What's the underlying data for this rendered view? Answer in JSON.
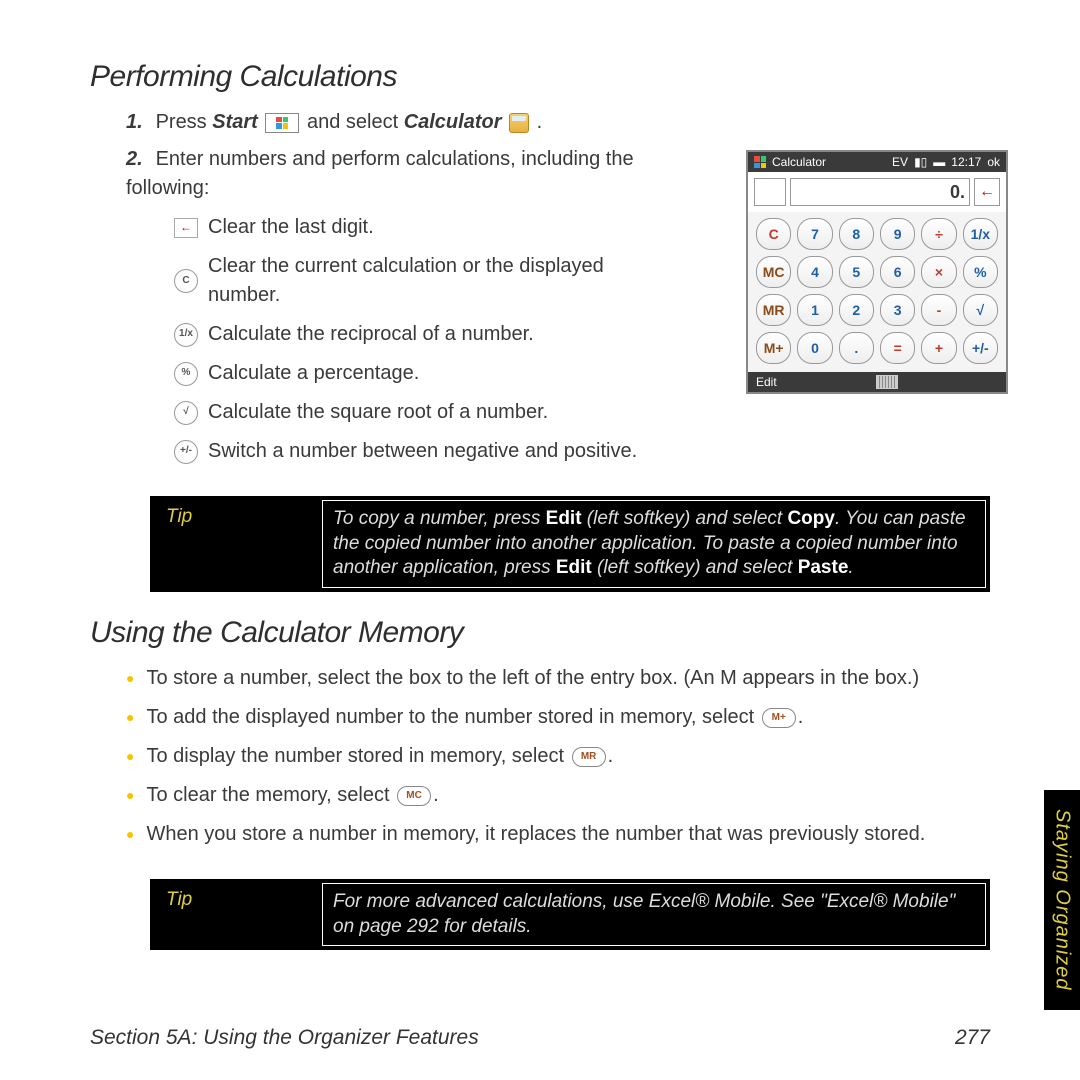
{
  "h1": "Performing Calculations",
  "step1_a": "Press ",
  "step1_start": "Start",
  "step1_b": " and select ",
  "step1_calc": "Calculator",
  "step1_c": " .",
  "step2": "Enter numbers and perform calculations, including the following:",
  "sub": {
    "a": "Clear the last digit.",
    "b": "Clear the current calculation or the displayed number.",
    "c": "Calculate the reciprocal of a number.",
    "d": "Calculate a percentage.",
    "e": "Calculate the square root of a number.",
    "f": "Switch a number between negative and positive."
  },
  "tip1_label": "Tip",
  "tip1_a": "To copy a number, press ",
  "tip1_edit1": "Edit",
  "tip1_b": " (left softkey) and select ",
  "tip1_copy": "Copy",
  "tip1_c": ". You can paste the copied number into another application. To paste a copied number into another application, press ",
  "tip1_edit2": "Edit",
  "tip1_d": " (left softkey) and select ",
  "tip1_paste": "Paste",
  "tip1_e": ".",
  "h2": "Using the Calculator Memory",
  "bul": {
    "a": "To store a number, select the box to the left of the entry box. (An M appears in the box.)",
    "b_a": "To add the displayed number to the number stored in memory, select ",
    "b_key": "M+",
    "b_b": ".",
    "c_a": "To display the number stored in memory, select ",
    "c_key": "MR",
    "c_b": ".",
    "d_a": "To clear the memory, select ",
    "d_key": "MC",
    "d_b": ".",
    "e": "When you store a number in memory, it replaces the number that was previously stored."
  },
  "tip2_label": "Tip",
  "tip2_text": "For more advanced calculations, use Excel® Mobile. See \"Excel® Mobile\" on page 292 for details.",
  "footer_left": "Section 5A: Using the Organizer Features",
  "footer_right": "277",
  "sidetab": "Staying Organized",
  "calc": {
    "title": "Calculator",
    "status_ev": "EV",
    "time": "12:17",
    "ok": "ok",
    "display": "0.",
    "backspace": "←",
    "keys": [
      [
        "C",
        "red"
      ],
      [
        "7",
        "blue"
      ],
      [
        "8",
        "blue"
      ],
      [
        "9",
        "blue"
      ],
      [
        "÷",
        "red"
      ],
      [
        "1/x",
        "blue"
      ],
      [
        "MC",
        "brown"
      ],
      [
        "4",
        "blue"
      ],
      [
        "5",
        "blue"
      ],
      [
        "6",
        "blue"
      ],
      [
        "×",
        "red"
      ],
      [
        "%",
        "blue"
      ],
      [
        "MR",
        "brown"
      ],
      [
        "1",
        "blue"
      ],
      [
        "2",
        "blue"
      ],
      [
        "3",
        "blue"
      ],
      [
        "-",
        "red"
      ],
      [
        "√",
        "blue"
      ],
      [
        "M+",
        "brown"
      ],
      [
        "0",
        "blue"
      ],
      [
        ".",
        "blue"
      ],
      [
        "=",
        "red"
      ],
      [
        "+",
        "red"
      ],
      [
        "+/-",
        "blue"
      ]
    ],
    "edit": "Edit"
  }
}
